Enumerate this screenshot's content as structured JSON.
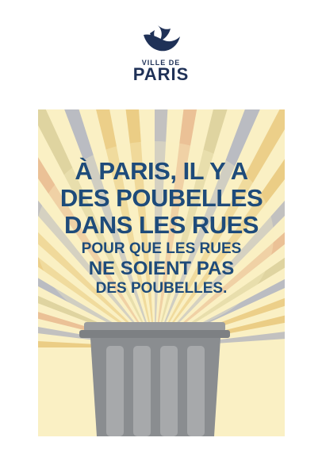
{
  "brand": {
    "logo_icon": "ship-icon",
    "line1": "VILLE DE",
    "line2": "PARIS",
    "color": "#1f3157"
  },
  "poster": {
    "background": "#faf0c4",
    "text_color": "#1e4b7a",
    "headline": [
      "À PARIS, IL Y A",
      "DES POUBELLES",
      "DANS LES RUES",
      "POUR QUE LES RUES",
      "NE SOIENT PAS",
      "DES POUBELLES."
    ],
    "illustration": "trash-can-icon"
  }
}
